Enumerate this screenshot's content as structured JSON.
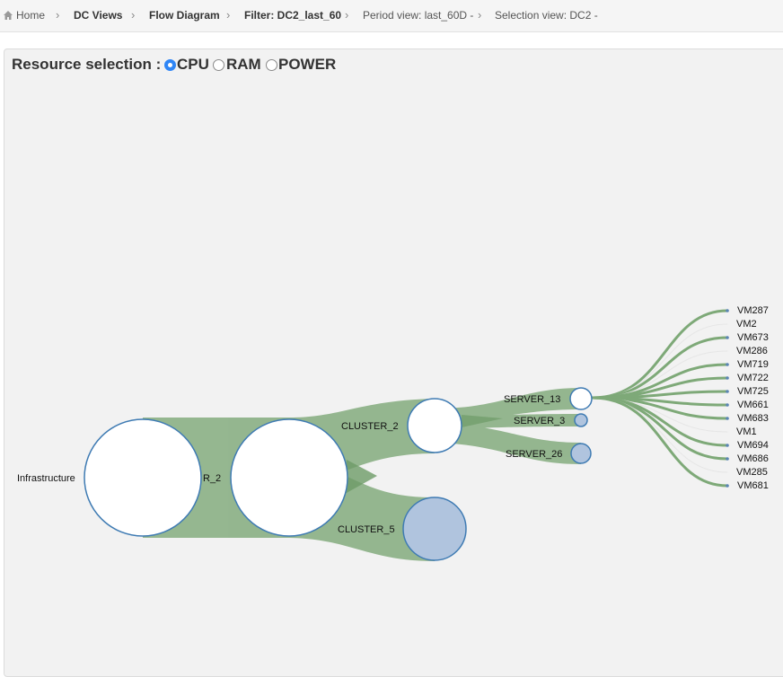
{
  "breadcrumb": {
    "home": "Home",
    "dc_views": "DC Views",
    "flow_diagram": "Flow Diagram",
    "filter": "Filter: DC2_last_60",
    "period": "Period view: last_60D -",
    "selection": "Selection view: DC2 -"
  },
  "resource_selection": {
    "label": "Resource selection :",
    "options": [
      "CPU",
      "RAM",
      "POWER"
    ],
    "selected": "CPU"
  },
  "colors": {
    "flow": "#8fb38a",
    "node_stroke": "#3f7bb3",
    "node_filled": "#b0c4de",
    "radio_accent": "#2f86f6"
  },
  "diagram": {
    "nodes": {
      "infrastructure": "Infrastructure",
      "dc2_partial": "R_2",
      "cluster_2": "CLUSTER_2",
      "cluster_5": "CLUSTER_5",
      "server_13": "SERVER_13",
      "server_3": "SERVER_3",
      "server_26": "SERVER_26"
    },
    "vms": [
      "VM287",
      "VM2",
      "VM673",
      "VM286",
      "VM719",
      "VM722",
      "VM725",
      "VM661",
      "VM683",
      "VM1",
      "VM694",
      "VM686",
      "VM285",
      "VM681"
    ]
  }
}
